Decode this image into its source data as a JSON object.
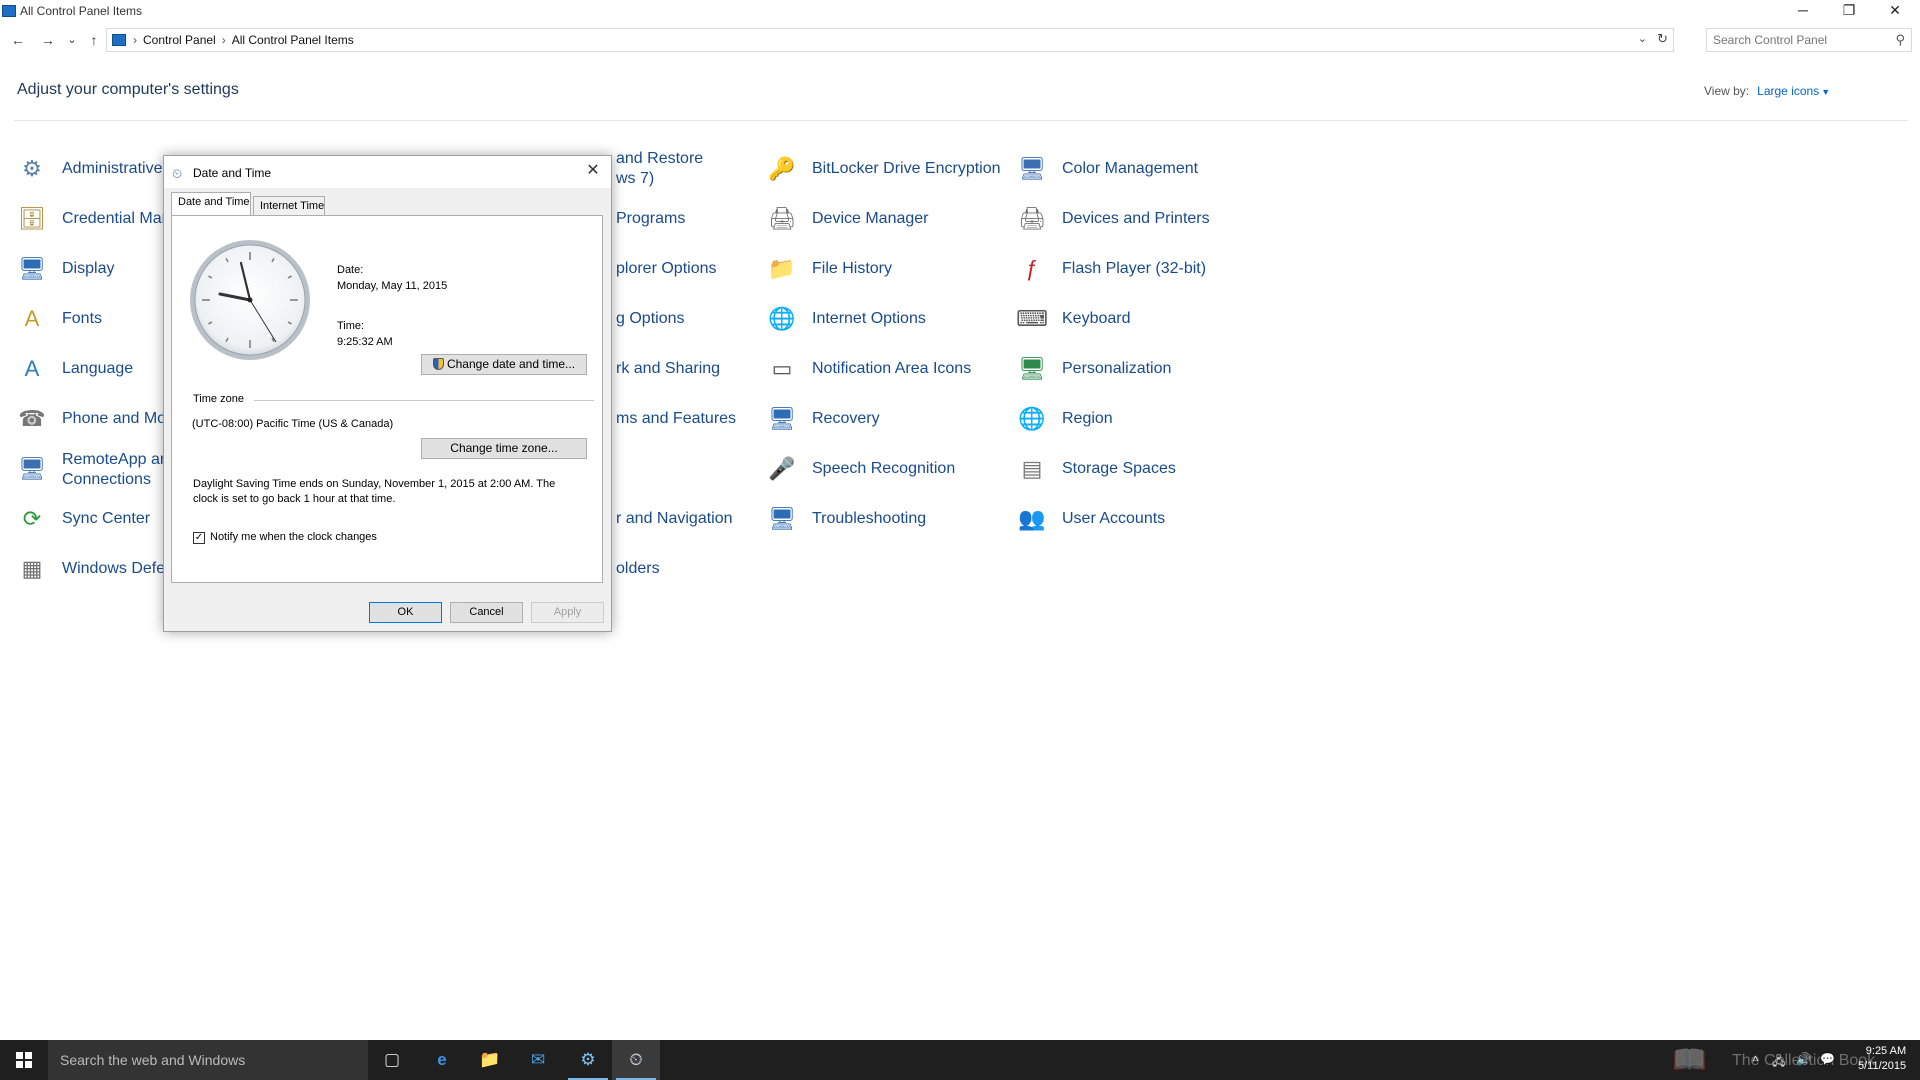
{
  "window": {
    "title": "All Control Panel Items",
    "min": "─",
    "max": "❐",
    "close": "✕"
  },
  "nav": {
    "back": "←",
    "forward": "→",
    "recent": "⌄",
    "up": "↑",
    "breadcrumb": [
      "Control Panel",
      "All Control Panel Items"
    ],
    "sep": "›",
    "dropdown": "⌄",
    "refresh": "↻",
    "search_placeholder": "Search Control Panel",
    "search_glyph": "⚲"
  },
  "header": {
    "title": "Adjust your computer's settings",
    "view_by_label": "View by:",
    "view_by_value": "Large icons",
    "caret": "▼"
  },
  "items": {
    "col1": [
      {
        "label": "Administrative",
        "icon": "⚙",
        "color": "#5a7fa8"
      },
      {
        "label": "Credential Mar",
        "icon": "🗄",
        "color": "#b08b3c"
      },
      {
        "label": "Display",
        "icon": "🖥",
        "color": "#2d6db5"
      },
      {
        "label": "Fonts",
        "icon": "A",
        "color": "#c59a2a"
      },
      {
        "label": "Language",
        "icon": "A",
        "color": "#2a7cc7"
      },
      {
        "label": "Phone and Mo",
        "icon": "☎",
        "color": "#777777"
      },
      {
        "label": "RemoteApp an",
        "label2": "Connections",
        "icon": "🖥",
        "color": "#3c6fb1"
      },
      {
        "label": "Sync Center",
        "icon": "⟳",
        "color": "#2e9b3a"
      },
      {
        "label": "Windows Defe",
        "icon": "▦",
        "color": "#707070"
      }
    ],
    "col2": [
      {
        "label": "and Restore",
        "label2": "ws 7)"
      },
      {
        "label": "Programs"
      },
      {
        "label": "plorer Options"
      },
      {
        "label": "g Options"
      },
      {
        "label": "rk and Sharing"
      },
      {
        "label": "ms and Features"
      },
      {
        "label": ""
      },
      {
        "label": "r and Navigation"
      },
      {
        "label": "olders"
      }
    ],
    "col3": [
      {
        "label": "BitLocker Drive Encryption",
        "icon": "🔑",
        "color": "#8c7a55"
      },
      {
        "label": "Device Manager",
        "icon": "🖨",
        "color": "#707070"
      },
      {
        "label": "File History",
        "icon": "📁",
        "color": "#d8b24a"
      },
      {
        "label": "Internet Options",
        "icon": "🌐",
        "color": "#2b7fc3"
      },
      {
        "label": "Notification Area Icons",
        "icon": "▭",
        "color": "#555555"
      },
      {
        "label": "Recovery",
        "icon": "🖥",
        "color": "#2d6db5"
      },
      {
        "label": "Speech Recognition",
        "icon": "🎤",
        "color": "#888888"
      },
      {
        "label": "Troubleshooting",
        "icon": "🖥",
        "color": "#2d6db5"
      }
    ],
    "col4": [
      {
        "label": "Color Management",
        "icon": "🖥",
        "color": "#3c6fb1"
      },
      {
        "label": "Devices and Printers",
        "icon": "🖨",
        "color": "#707070"
      },
      {
        "label": "Flash Player (32-bit)",
        "icon": "ƒ",
        "color": "#cc1f1f"
      },
      {
        "label": "Keyboard",
        "icon": "⌨",
        "color": "#555555"
      },
      {
        "label": "Personalization",
        "icon": "🖥",
        "color": "#2d8a4a"
      },
      {
        "label": "Region",
        "icon": "🌐",
        "color": "#2b7fc3"
      },
      {
        "label": "Storage Spaces",
        "icon": "▤",
        "color": "#777777"
      },
      {
        "label": "User Accounts",
        "icon": "👥",
        "color": "#4a82b7"
      }
    ]
  },
  "dialog": {
    "title": "Date and Time",
    "title_icon": "⏲",
    "close": "✕",
    "tabs": [
      "Date and Time",
      "Internet Time"
    ],
    "date_label": "Date:",
    "date_value": "Monday, May 11, 2015",
    "time_label": "Time:",
    "time_value": "9:25:32 AM",
    "change_datetime_button": "Change date and time...",
    "timezone_group": "Time zone",
    "timezone_value": "(UTC-08:00) Pacific Time (US & Canada)",
    "change_timezone_button": "Change time zone...",
    "dst_line1": "Daylight Saving Time ends on Sunday, November 1, 2015 at 2:00 AM. The",
    "dst_line2": "clock is set to go back 1 hour at that time.",
    "notify_checked": "✓",
    "notify_label": "Notify me when the clock changes",
    "ok": "OK",
    "cancel": "Cancel",
    "apply": "Apply"
  },
  "taskbar": {
    "search_placeholder": "Search the web and Windows",
    "icons": [
      "▢",
      "e",
      "📁",
      "✉",
      "⚙",
      "⏲"
    ],
    "tray": [
      "˄",
      "🖧",
      "🔊",
      "💬"
    ],
    "time": "9:25 AM",
    "date": "5/11/2015",
    "watermark": "The Collection Book",
    "watermark_glyph": "📖"
  },
  "colors": {
    "link": "#1a4b8c",
    "heading": "#1e395b",
    "accent": "#0078d7",
    "taskbar": "#1f1f1f"
  }
}
